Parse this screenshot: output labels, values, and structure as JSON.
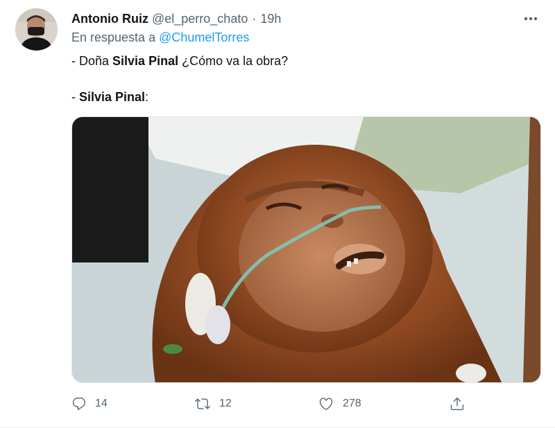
{
  "tweet": {
    "author_name": "Antonio Ruiz",
    "author_handle": "@el_perro_chato",
    "separator": "·",
    "time": "19h",
    "reply_prefix": "En respuesta a",
    "reply_mention": "@ChumelTorres",
    "line1_pre": "- Doña ",
    "line1_bold": "Silvia Pinal",
    "line1_post": " ¿Cómo va la obra?",
    "line2_pre": "- ",
    "line2_bold": "Silvia Pinal",
    "line2_post": ":"
  },
  "actions": {
    "reply_count": "14",
    "retweet_count": "12",
    "like_count": "278"
  },
  "icons": {
    "more": "more-horizontal-icon",
    "reply": "reply-bubble-icon",
    "retweet": "retweet-icon",
    "like": "heart-icon",
    "share": "share-icon"
  },
  "colors": {
    "link": "#1d9bf0",
    "secondary_text": "#536471",
    "primary_text": "#0f1419"
  }
}
